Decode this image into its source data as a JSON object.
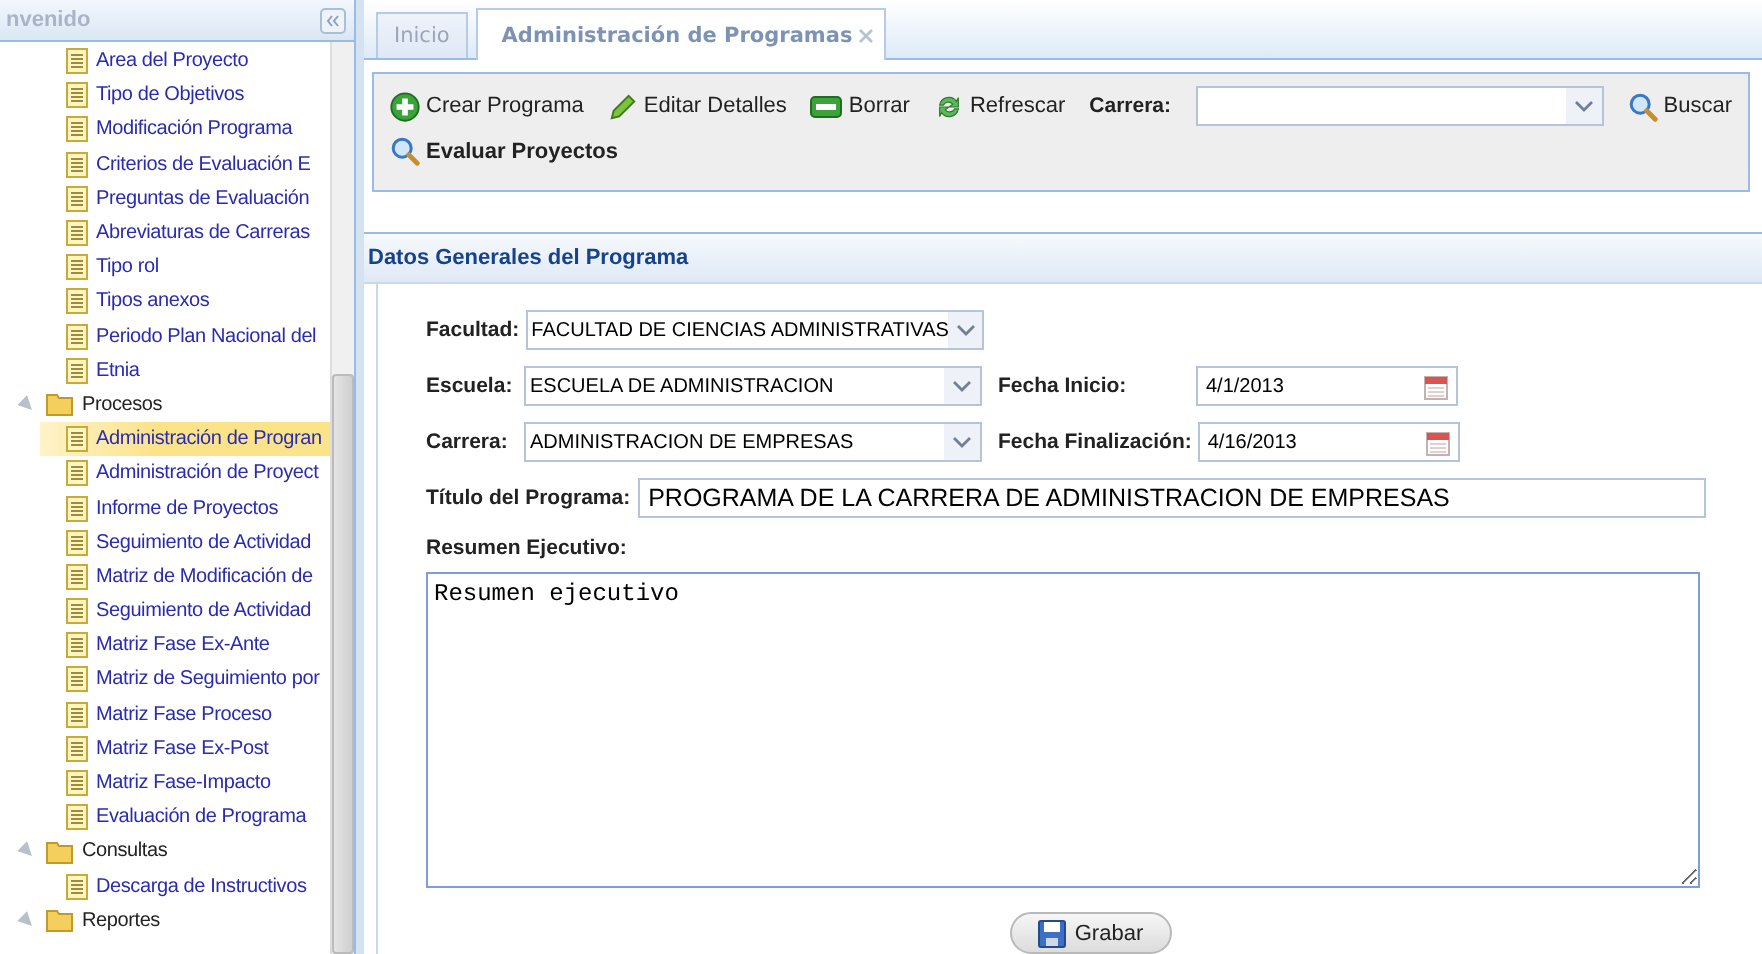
{
  "sidebar": {
    "title": "nvenido",
    "tree": [
      {
        "kind": "leaf",
        "label": "Area del Proyecto",
        "selected": false
      },
      {
        "kind": "leaf",
        "label": "Tipo de Objetivos",
        "selected": false
      },
      {
        "kind": "leaf",
        "label": "Modificación Programa",
        "selected": false
      },
      {
        "kind": "leaf",
        "label": "Criterios de Evaluación E",
        "selected": false
      },
      {
        "kind": "leaf",
        "label": "Preguntas de Evaluación",
        "selected": false
      },
      {
        "kind": "leaf",
        "label": "Abreviaturas de Carreras",
        "selected": false
      },
      {
        "kind": "leaf",
        "label": "Tipo rol",
        "selected": false
      },
      {
        "kind": "leaf",
        "label": "Tipos anexos",
        "selected": false
      },
      {
        "kind": "leaf",
        "label": "Periodo Plan Nacional del",
        "selected": false
      },
      {
        "kind": "leaf",
        "label": "Etnia",
        "selected": false
      },
      {
        "kind": "folder",
        "label": "Procesos",
        "expanded": true,
        "children": [
          {
            "kind": "leaf",
            "label": "Administración de Progran",
            "selected": true
          },
          {
            "kind": "leaf",
            "label": "Administración de Proyect",
            "selected": false
          },
          {
            "kind": "leaf",
            "label": "Informe de Proyectos",
            "selected": false
          },
          {
            "kind": "leaf",
            "label": "Seguimiento de Actividad",
            "selected": false
          },
          {
            "kind": "leaf",
            "label": "Matriz de Modificación de",
            "selected": false
          },
          {
            "kind": "leaf",
            "label": "Seguimiento de Actividad",
            "selected": false
          },
          {
            "kind": "leaf",
            "label": "Matriz Fase Ex-Ante",
            "selected": false
          },
          {
            "kind": "leaf",
            "label": "Matriz de Seguimiento por",
            "selected": false
          },
          {
            "kind": "leaf",
            "label": "Matriz Fase Proceso",
            "selected": false
          },
          {
            "kind": "leaf",
            "label": "Matriz Fase Ex-Post",
            "selected": false
          },
          {
            "kind": "leaf",
            "label": "Matriz Fase-Impacto",
            "selected": false
          },
          {
            "kind": "leaf",
            "label": "Evaluación de Programa",
            "selected": false
          }
        ]
      },
      {
        "kind": "folder",
        "label": "Consultas",
        "expanded": true,
        "children": [
          {
            "kind": "leaf",
            "label": "Descarga de Instructivos",
            "selected": false
          }
        ]
      },
      {
        "kind": "folder",
        "label": "Reportes",
        "expanded": true
      }
    ]
  },
  "tabs": [
    {
      "label": "Inicio",
      "selected": false,
      "closable": false
    },
    {
      "label": "Administración de Programas",
      "selected": true,
      "closable": true
    }
  ],
  "toolbar": {
    "buttons": [
      {
        "label": "Crear Programa",
        "kind": "create"
      },
      {
        "label": "Editar Detalles",
        "kind": "edit"
      },
      {
        "label": "Borrar",
        "kind": "delete"
      },
      {
        "label": "Refrescar",
        "kind": "refresh"
      }
    ],
    "filter": {
      "label": "Carrera:"
    },
    "search_button": {
      "label": "Buscar"
    },
    "evaluate_button": {
      "label": "Evaluar Proyectos"
    }
  },
  "form": {
    "title": "Datos Generales del Programa",
    "facultad": {
      "label": "Facultad:",
      "value": "FACULTAD DE CIENCIAS ADMINISTRATIVAS"
    },
    "escuela": {
      "label": "Escuela:",
      "value": "ESCUELA DE ADMINISTRACION"
    },
    "fecha_inicio": {
      "label": "Fecha Inicio:",
      "value": "4/1/2013"
    },
    "carrera": {
      "label": "Carrera:",
      "value": "ADMINISTRACION DE EMPRESAS"
    },
    "fecha_fin": {
      "label": "Fecha Finalización:",
      "value": "4/16/2013"
    },
    "titulo": {
      "label": "Título del Programa:",
      "value": "PROGRAMA DE LA CARRERA DE ADMINISTRACION DE EMPRESAS"
    },
    "resumen": {
      "label": "Resumen Ejecutivo:",
      "value": "Resumen ejecutivo"
    },
    "save_button": {
      "label": "Grabar"
    }
  }
}
